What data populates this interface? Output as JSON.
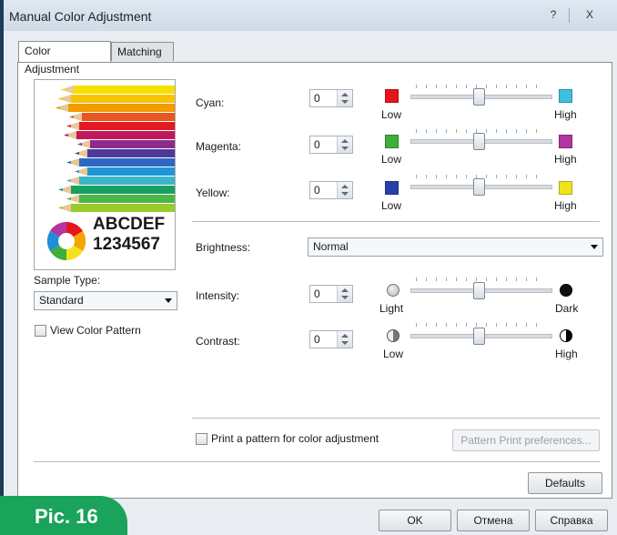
{
  "window": {
    "title": "Manual Color Adjustment",
    "help_glyph": "?",
    "close_glyph": "X"
  },
  "tabs": [
    {
      "label": "Color Adjustment",
      "active": true
    },
    {
      "label": "Matching",
      "active": false
    }
  ],
  "preview": {
    "line1": "ABCDEF",
    "line2": "1234567"
  },
  "sample_type": {
    "label": "Sample Type:",
    "value": "Standard"
  },
  "view_color_pattern": {
    "label": "View Color Pattern",
    "checked": false
  },
  "colors": [
    {
      "label": "Cyan:",
      "value": "0",
      "low_label": "Low",
      "high_label": "High",
      "low_color": "#e8141c",
      "high_color": "#3fc0e0"
    },
    {
      "label": "Magenta:",
      "value": "0",
      "low_label": "Low",
      "high_label": "High",
      "low_color": "#3fae3a",
      "high_color": "#b3359f"
    },
    {
      "label": "Yellow:",
      "value": "0",
      "low_label": "Low",
      "high_label": "High",
      "low_color": "#2640a8",
      "high_color": "#f2e21c"
    }
  ],
  "brightness": {
    "label": "Brightness:",
    "value": "Normal"
  },
  "intensity": {
    "label": "Intensity:",
    "value": "0",
    "low_label": "Light",
    "high_label": "Dark",
    "low_icon": "light-circle-icon",
    "high_icon": "dark-circle-icon"
  },
  "contrast": {
    "label": "Contrast:",
    "value": "0",
    "low_label": "Low",
    "high_label": "High",
    "low_icon": "low-contrast-icon",
    "high_icon": "high-contrast-icon"
  },
  "print_pattern": {
    "label": "Print a pattern for color adjustment",
    "checked": false
  },
  "buttons": {
    "pattern_prefs": "Pattern Print preferences...",
    "defaults": "Defaults",
    "ok": "OK",
    "cancel": "Отмена",
    "help": "Справка"
  },
  "caption": "Pic. 16",
  "theme": {
    "accent_green": "#1aa35a"
  }
}
